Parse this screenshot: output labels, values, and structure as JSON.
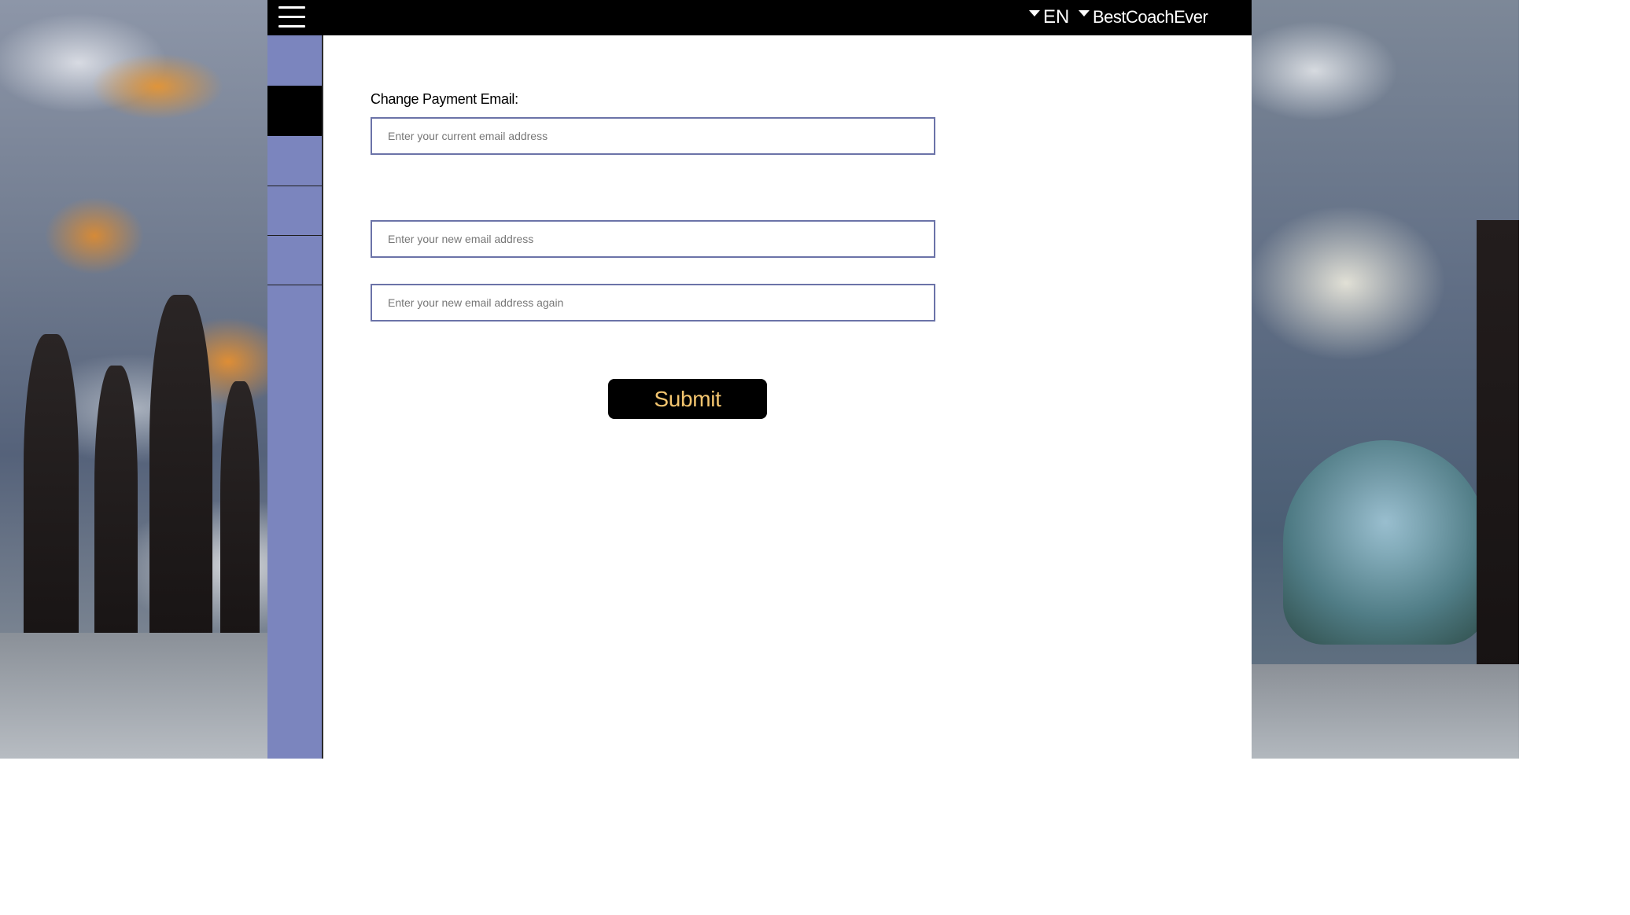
{
  "header": {
    "language": "EN",
    "username": "BestCoachEver"
  },
  "sidebar": {
    "active_item_index": 1,
    "items": [
      {
        "icon": "menu-slot"
      },
      {
        "icon": "menu-slot"
      },
      {
        "icon": "menu-slot"
      },
      {
        "icon": "menu-slot"
      },
      {
        "icon": "menu-slot"
      }
    ]
  },
  "form": {
    "label": "Change Payment Email:",
    "current_email": {
      "value": "",
      "placeholder": "Enter your current email address"
    },
    "new_email": {
      "value": "",
      "placeholder": "Enter your new email address"
    },
    "confirm_email": {
      "value": "",
      "placeholder": "Enter your new email address again"
    },
    "submit_label": "Submit"
  },
  "colors": {
    "topbar": "#000000",
    "sidebar": "#7b85be",
    "sidebar_active": "#000000",
    "input_border": "#6b73a8",
    "submit_bg": "#000000",
    "submit_text": "#f3c56f"
  }
}
